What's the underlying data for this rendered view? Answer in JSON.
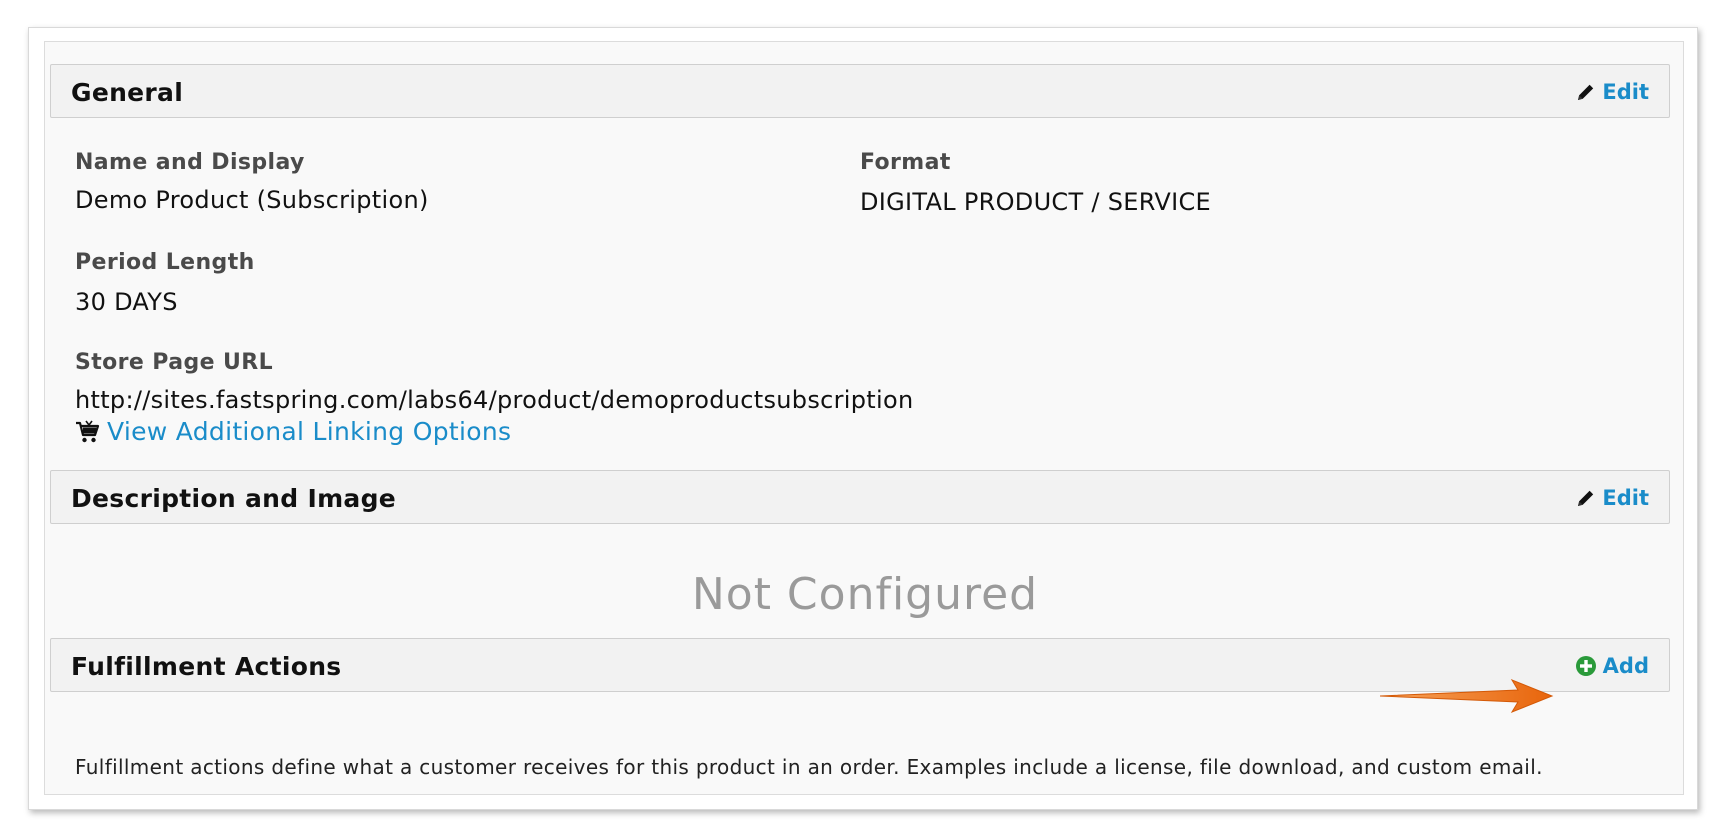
{
  "general": {
    "title": "General",
    "edit_label": "Edit",
    "name_label": "Name and Display",
    "name_value": "Demo Product (Subscription)",
    "format_label": "Format",
    "format_value": "DIGITAL PRODUCT / SERVICE",
    "period_label": "Period Length",
    "period_value": "30 DAYS",
    "url_label": "Store Page URL",
    "url_value": "http://sites.fastspring.com/labs64/product/demoproductsubscription",
    "linking_label": "View Additional Linking Options"
  },
  "description": {
    "title": "Description and Image",
    "edit_label": "Edit",
    "status": "Not Configured"
  },
  "fulfillment": {
    "title": "Fulfillment Actions",
    "add_label": "Add",
    "text": "Fulfillment actions define what a customer receives for this product in an order. Examples include a license, file download, and custom email."
  },
  "colors": {
    "link": "#1a8cc9",
    "add_icon": "#2a9a3a",
    "arrow": "#f07a1a",
    "muted": "#9a9a9a"
  },
  "icons": {
    "edit": "pencil-icon",
    "cart": "cart-icon",
    "add": "plus-circle-icon",
    "annotation": "arrow-icon"
  }
}
